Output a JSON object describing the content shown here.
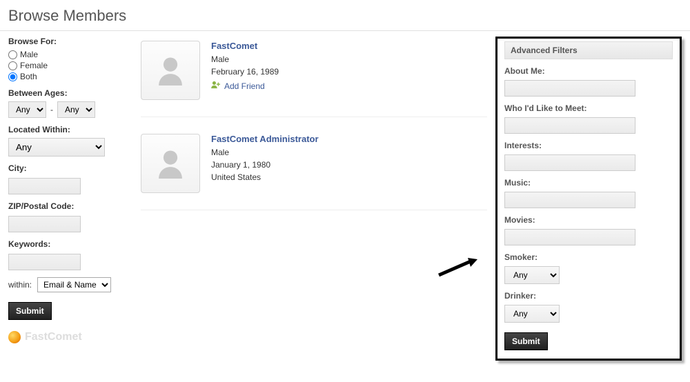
{
  "page_title": "Browse Members",
  "left_filters": {
    "browse_for_label": "Browse For:",
    "opt_male": "Male",
    "opt_female": "Female",
    "opt_both": "Both",
    "between_ages_label": "Between Ages:",
    "age_min": "Any",
    "age_max": "Any",
    "age_sep": "-",
    "located_within_label": "Located Within:",
    "located_within_value": "Any",
    "city_label": "City:",
    "zip_label": "ZIP/Postal Code:",
    "keywords_label": "Keywords:",
    "within_label": "within:",
    "within_value": "Email & Name",
    "submit_label": "Submit"
  },
  "brand": {
    "text": "FastComet"
  },
  "members": [
    {
      "name": "FastComet",
      "gender": "Male",
      "dob": "February 16, 1989",
      "country": "",
      "add_friend_label": "Add Friend"
    },
    {
      "name": "FastComet Administrator",
      "gender": "Male",
      "dob": "January 1, 1980",
      "country": "United States",
      "add_friend_label": ""
    }
  ],
  "advanced": {
    "header": "Advanced Filters",
    "about_me_label": "About Me:",
    "meet_label": "Who I'd Like to Meet:",
    "interests_label": "Interests:",
    "music_label": "Music:",
    "movies_label": "Movies:",
    "smoker_label": "Smoker:",
    "smoker_value": "Any",
    "drinker_label": "Drinker:",
    "drinker_value": "Any",
    "submit_label": "Submit"
  }
}
